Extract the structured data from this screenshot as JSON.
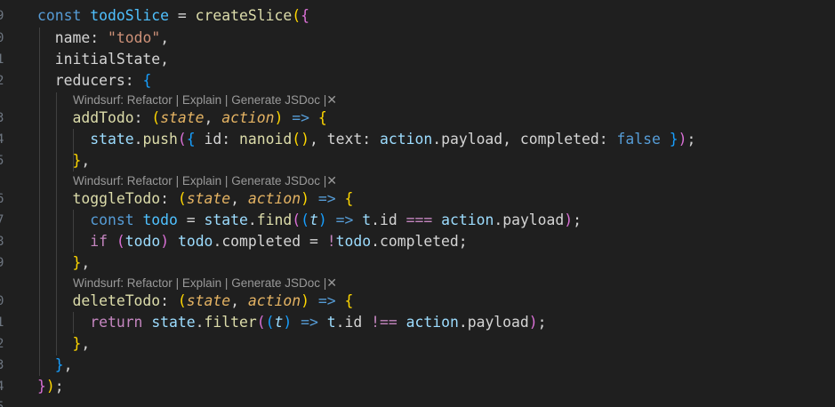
{
  "editor": {
    "line_numbers": [
      "9",
      "0",
      "1",
      "2",
      "3",
      "4",
      "5",
      "6",
      "7",
      "8",
      "9",
      "0",
      "1",
      "2",
      "3",
      "4",
      "5"
    ],
    "codelens": {
      "prefix": "Windsurf:",
      "refactor": "Refactor",
      "explain": "Explain",
      "jsdoc": "Generate JSDoc",
      "separator": "|",
      "close": "✕"
    },
    "lines": [
      [
        [
          "kw",
          "const"
        ],
        [
          "pln",
          " "
        ],
        [
          "cst",
          "todoSlice"
        ],
        [
          "pln",
          " "
        ],
        [
          "op",
          "="
        ],
        [
          "pln",
          " "
        ],
        [
          "fn",
          "createSlice"
        ],
        [
          "b1",
          "("
        ],
        [
          "b2",
          "{"
        ]
      ],
      [
        [
          "pln",
          "  "
        ],
        [
          "pr",
          "name"
        ],
        [
          "pln",
          ": "
        ],
        [
          "str",
          "\"todo\""
        ],
        [
          "pln",
          ","
        ]
      ],
      [
        [
          "pln",
          "  "
        ],
        [
          "pr",
          "initialState"
        ],
        [
          "pln",
          ","
        ]
      ],
      [
        [
          "pln",
          "  "
        ],
        [
          "pr",
          "reducers"
        ],
        [
          "pln",
          ": "
        ],
        [
          "b3",
          "{"
        ]
      ],
      [
        [
          "pln",
          "    "
        ],
        [
          "fn",
          "addTodo"
        ],
        [
          "pln",
          ": "
        ],
        [
          "b1",
          "("
        ],
        [
          "prm2",
          "state"
        ],
        [
          "pln",
          ", "
        ],
        [
          "prm2",
          "action"
        ],
        [
          "b1",
          ")"
        ],
        [
          "pln",
          " "
        ],
        [
          "arrow",
          "=>"
        ],
        [
          "pln",
          " "
        ],
        [
          "b1",
          "{"
        ]
      ],
      [
        [
          "pln",
          "      "
        ],
        [
          "var",
          "state"
        ],
        [
          "pln",
          "."
        ],
        [
          "fn",
          "push"
        ],
        [
          "b2",
          "("
        ],
        [
          "b3",
          "{"
        ],
        [
          "pln",
          " "
        ],
        [
          "pr",
          "id"
        ],
        [
          "pln",
          ": "
        ],
        [
          "fn",
          "nanoid"
        ],
        [
          "b1",
          "()"
        ],
        [
          "pln",
          ", "
        ],
        [
          "pr",
          "text"
        ],
        [
          "pln",
          ": "
        ],
        [
          "var",
          "action"
        ],
        [
          "pln",
          "."
        ],
        [
          "pr",
          "payload"
        ],
        [
          "pln",
          ", "
        ],
        [
          "pr",
          "completed"
        ],
        [
          "pln",
          ": "
        ],
        [
          "bool",
          "false"
        ],
        [
          "pln",
          " "
        ],
        [
          "b3",
          "}"
        ],
        [
          "b2",
          ")"
        ],
        [
          "pln",
          ";"
        ]
      ],
      [
        [
          "pln",
          "    "
        ],
        [
          "b1",
          "}"
        ],
        [
          "pln",
          ","
        ]
      ],
      [
        [
          "pln",
          "    "
        ],
        [
          "fn",
          "toggleTodo"
        ],
        [
          "pln",
          ": "
        ],
        [
          "b1",
          "("
        ],
        [
          "prm2",
          "state"
        ],
        [
          "pln",
          ", "
        ],
        [
          "prm2",
          "action"
        ],
        [
          "b1",
          ")"
        ],
        [
          "pln",
          " "
        ],
        [
          "arrow",
          "=>"
        ],
        [
          "pln",
          " "
        ],
        [
          "b1",
          "{"
        ]
      ],
      [
        [
          "pln",
          "      "
        ],
        [
          "kw",
          "const"
        ],
        [
          "pln",
          " "
        ],
        [
          "cst",
          "todo"
        ],
        [
          "pln",
          " "
        ],
        [
          "op",
          "="
        ],
        [
          "pln",
          " "
        ],
        [
          "var",
          "state"
        ],
        [
          "pln",
          "."
        ],
        [
          "fn",
          "find"
        ],
        [
          "b2",
          "("
        ],
        [
          "b3",
          "("
        ],
        [
          "prm",
          "t"
        ],
        [
          "b3",
          ")"
        ],
        [
          "pln",
          " "
        ],
        [
          "arrow",
          "=>"
        ],
        [
          "pln",
          " "
        ],
        [
          "var",
          "t"
        ],
        [
          "pln",
          "."
        ],
        [
          "pr",
          "id"
        ],
        [
          "pln",
          " "
        ],
        [
          "ctl",
          "==="
        ],
        [
          "pln",
          " "
        ],
        [
          "var",
          "action"
        ],
        [
          "pln",
          "."
        ],
        [
          "pr",
          "payload"
        ],
        [
          "b2",
          ")"
        ],
        [
          "pln",
          ";"
        ]
      ],
      [
        [
          "pln",
          "      "
        ],
        [
          "ctl",
          "if"
        ],
        [
          "pln",
          " "
        ],
        [
          "b2",
          "("
        ],
        [
          "var",
          "todo"
        ],
        [
          "b2",
          ")"
        ],
        [
          "pln",
          " "
        ],
        [
          "var",
          "todo"
        ],
        [
          "pln",
          "."
        ],
        [
          "pr",
          "completed"
        ],
        [
          "pln",
          " "
        ],
        [
          "op",
          "="
        ],
        [
          "pln",
          " "
        ],
        [
          "ctl",
          "!"
        ],
        [
          "var",
          "todo"
        ],
        [
          "pln",
          "."
        ],
        [
          "pr",
          "completed"
        ],
        [
          "pln",
          ";"
        ]
      ],
      [
        [
          "pln",
          "    "
        ],
        [
          "b1",
          "}"
        ],
        [
          "pln",
          ","
        ]
      ],
      [
        [
          "pln",
          "    "
        ],
        [
          "fn",
          "deleteTodo"
        ],
        [
          "pln",
          ": "
        ],
        [
          "b1",
          "("
        ],
        [
          "prm2",
          "state"
        ],
        [
          "pln",
          ", "
        ],
        [
          "prm2",
          "action"
        ],
        [
          "b1",
          ")"
        ],
        [
          "pln",
          " "
        ],
        [
          "arrow",
          "=>"
        ],
        [
          "pln",
          " "
        ],
        [
          "b1",
          "{"
        ]
      ],
      [
        [
          "pln",
          "      "
        ],
        [
          "ctl",
          "return"
        ],
        [
          "pln",
          " "
        ],
        [
          "var",
          "state"
        ],
        [
          "pln",
          "."
        ],
        [
          "fn",
          "filter"
        ],
        [
          "b2",
          "("
        ],
        [
          "b3",
          "("
        ],
        [
          "prm",
          "t"
        ],
        [
          "b3",
          ")"
        ],
        [
          "pln",
          " "
        ],
        [
          "arrow",
          "=>"
        ],
        [
          "pln",
          " "
        ],
        [
          "var",
          "t"
        ],
        [
          "pln",
          "."
        ],
        [
          "pr",
          "id"
        ],
        [
          "pln",
          " "
        ],
        [
          "ctl",
          "!=="
        ],
        [
          "pln",
          " "
        ],
        [
          "var",
          "action"
        ],
        [
          "pln",
          "."
        ],
        [
          "pr",
          "payload"
        ],
        [
          "b2",
          ")"
        ],
        [
          "pln",
          ";"
        ]
      ],
      [
        [
          "pln",
          "    "
        ],
        [
          "b1",
          "}"
        ],
        [
          "pln",
          ","
        ]
      ],
      [
        [
          "pln",
          "  "
        ],
        [
          "b3",
          "}"
        ],
        [
          "pln",
          ","
        ]
      ],
      [
        [
          "b2",
          "}"
        ],
        [
          "b1",
          ")"
        ],
        [
          "pln",
          ";"
        ]
      ],
      []
    ]
  }
}
